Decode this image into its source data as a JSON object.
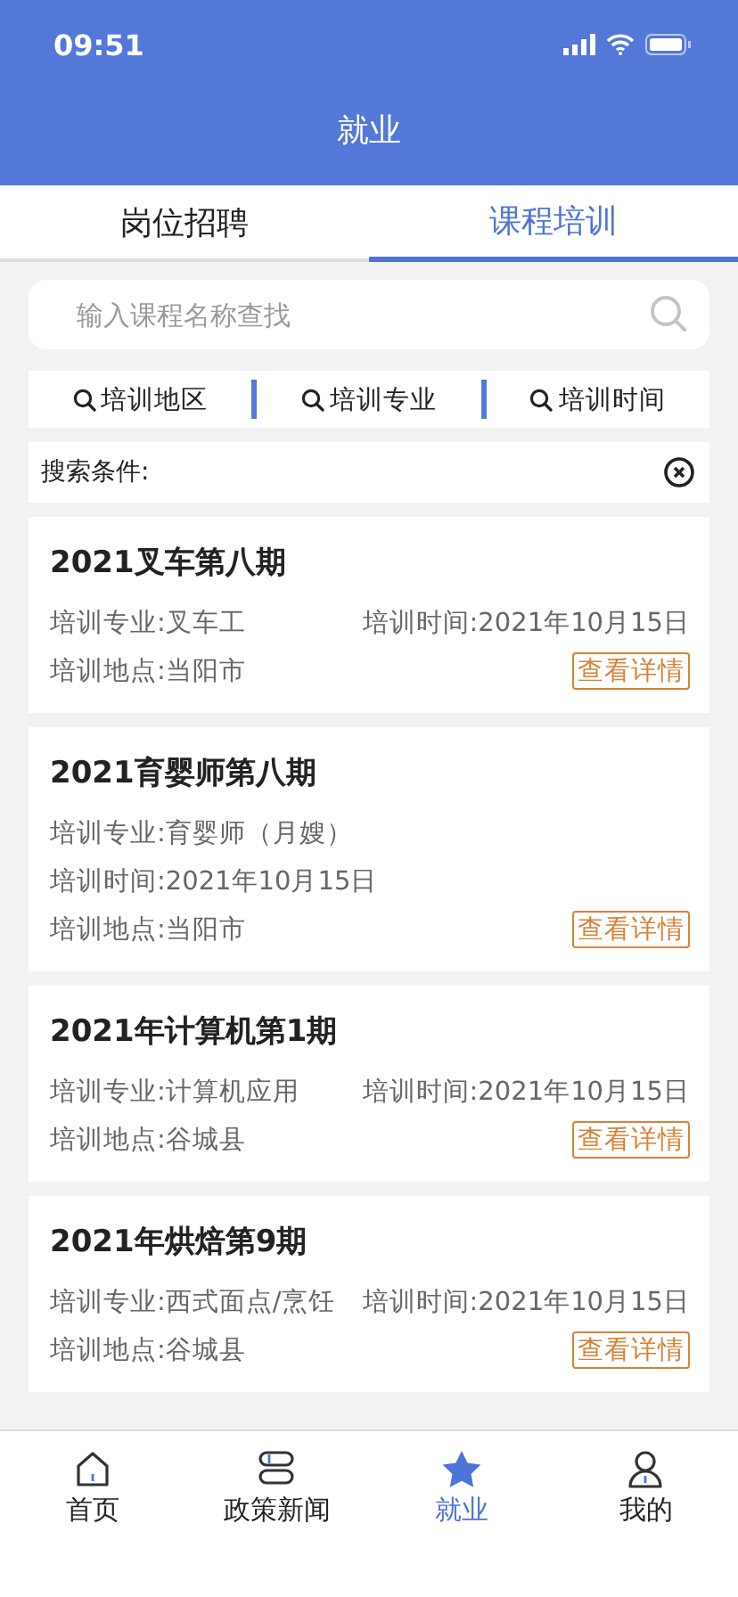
{
  "status_bar": {
    "time": "09:51"
  },
  "header": {
    "title": "就业"
  },
  "tabs": [
    {
      "label": "岗位招聘",
      "selected": false
    },
    {
      "label": "课程培训",
      "selected": true
    }
  ],
  "search": {
    "placeholder": "输入课程名称查找"
  },
  "filters": [
    "培训地区",
    "培训专业",
    "培训时间"
  ],
  "conditions": {
    "label": "搜索条件:"
  },
  "courses": [
    {
      "title": "2021叉车第八期",
      "rows": [
        {
          "left": "培训专业:叉车工",
          "right": "培训时间:2021年10月15日"
        },
        {
          "left": "培训地点:当阳市"
        }
      ],
      "detail_button": "查看详情"
    },
    {
      "title": "2021育婴师第八期",
      "rows": [
        {
          "left": "培训专业:育婴师（月嫂）"
        },
        {
          "left": "培训时间:2021年10月15日"
        },
        {
          "left": "培训地点:当阳市"
        }
      ],
      "detail_button": "查看详情"
    },
    {
      "title": "2021年计算机第1期",
      "rows": [
        {
          "left": "培训专业:计算机应用",
          "right": "培训时间:2021年10月15日"
        },
        {
          "left": "培训地点:谷城县"
        }
      ],
      "detail_button": "查看详情"
    },
    {
      "title": "2021年烘焙第9期",
      "rows": [
        {
          "left": "培训专业:西式面点/烹饪",
          "right": "培训时间:2021年10月15日"
        },
        {
          "left": "培训地点:谷城县"
        }
      ],
      "detail_button": "查看详情"
    }
  ],
  "nav": [
    {
      "kind": "home",
      "label": "首页",
      "selected": false
    },
    {
      "kind": "books",
      "label": "政策新闻",
      "selected": false
    },
    {
      "kind": "star",
      "label": "就业",
      "selected": true
    },
    {
      "kind": "person",
      "label": "我的",
      "selected": false
    }
  ]
}
